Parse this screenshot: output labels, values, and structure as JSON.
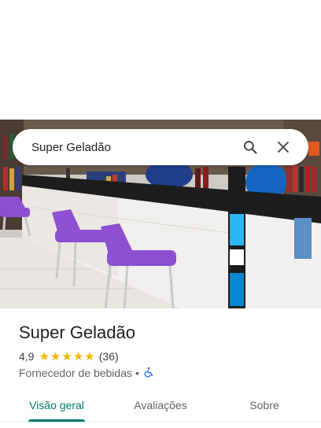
{
  "search": {
    "query": "Super Geladão",
    "search_icon": "search-icon",
    "close_icon": "close-icon"
  },
  "photo": {
    "alt": "Photo of the counter with purple chairs",
    "colors": {
      "chairs": "#8e4fd0",
      "counter": "#f2f0ee",
      "countertop": "#1d1d1d",
      "uniform": "#1565c0"
    }
  },
  "place": {
    "name": "Super Geladão",
    "rating": "4,9",
    "stars": 5,
    "review_count": "(36)",
    "category": "Fornecedor de bebidas",
    "separator": "•",
    "accessibility_icon": "wheelchair-icon"
  },
  "tabs": [
    {
      "label": "Visão geral",
      "active": true
    },
    {
      "label": "Avaliações",
      "active": false
    },
    {
      "label": "Sobre",
      "active": false
    }
  ],
  "colors": {
    "accent": "#00796b",
    "star": "#f4b400",
    "text": "#202124",
    "secondary": "#5f6368"
  }
}
